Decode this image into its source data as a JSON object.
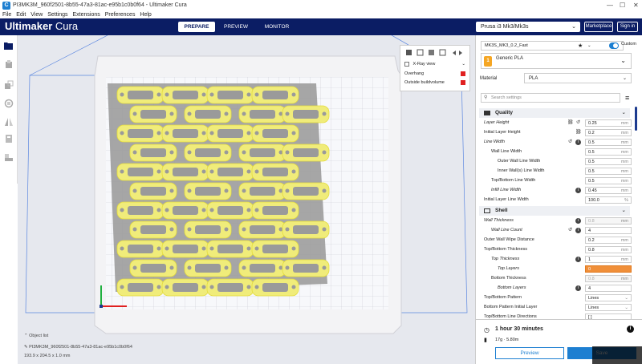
{
  "window": {
    "title": "PI3MK3M_960f2501-8b55-47a3-81ac-e95b1c0b0f64 - Ultimaker Cura",
    "app_icon": "C"
  },
  "menu": [
    "File",
    "Edit",
    "View",
    "Settings",
    "Extensions",
    "Preferences",
    "Help"
  ],
  "header": {
    "brand_bold": "Ultimaker",
    "brand_light": "Cura",
    "stages": [
      "PREPARE",
      "PREVIEW",
      "MONITOR"
    ],
    "active_stage": "PREPARE",
    "printer": "Prusa i3 Mk3/Mk3s",
    "marketplace": "Marketplace",
    "signin": "Sign in"
  },
  "toolbar": [
    "open-file-icon",
    "move-icon",
    "scale-icon",
    "rotate-icon",
    "mirror-icon",
    "per-model-settings-icon",
    "support-blocker-icon"
  ],
  "view_options": {
    "xray": "X-Ray view",
    "overhang": "Overhang",
    "outside": "Outside buildvolume",
    "overhang_color": "#e02020",
    "outside_color": "#e02020"
  },
  "panel": {
    "profile": "MK3S_MK3_0.2_Fast",
    "custom": "Custom",
    "extruder_badge": "1",
    "material_name": "Generic PLA",
    "material_label": "Material",
    "material_value": "PLA",
    "search_placeholder": "Search settings",
    "categories": {
      "quality": "Quality",
      "shell": "Shell"
    },
    "quality": [
      {
        "label": "Layer Height",
        "value": "0.25",
        "unit": "mm"
      },
      {
        "label": "Initial Layer Height",
        "value": "0.2",
        "unit": "mm"
      },
      {
        "label": "Line Width",
        "value": "0.5",
        "unit": "mm"
      },
      {
        "label": "Wall Line Width",
        "value": "0.5",
        "unit": "mm"
      },
      {
        "label": "Outer Wall Line Width",
        "value": "0.5",
        "unit": "mm"
      },
      {
        "label": "Inner Wall(s) Line Width",
        "value": "0.5",
        "unit": "mm"
      },
      {
        "label": "Top/Bottom Line Width",
        "value": "0.5",
        "unit": "mm"
      },
      {
        "label": "Infill Line Width",
        "value": "0.45",
        "unit": "mm"
      },
      {
        "label": "Initial Layer Line Width",
        "value": "100.0",
        "unit": "%"
      }
    ],
    "shell": [
      {
        "label": "Wall Thickness",
        "value": "0.8",
        "unit": "mm"
      },
      {
        "label": "Wall Line Count",
        "value": "4",
        "unit": ""
      },
      {
        "label": "Outer Wall Wipe Distance",
        "value": "0.2",
        "unit": "mm"
      },
      {
        "label": "Top/Bottom Thickness",
        "value": "0.8",
        "unit": "mm"
      },
      {
        "label": "Top Thickness",
        "value": "1",
        "unit": "mm"
      },
      {
        "label": "Top Layers",
        "value": "0",
        "unit": ""
      },
      {
        "label": "Bottom Thickness",
        "value": "0.8",
        "unit": "mm"
      },
      {
        "label": "Bottom Layers",
        "value": "4",
        "unit": ""
      },
      {
        "label": "Top/Bottom Pattern",
        "value": "Lines",
        "unit": ""
      },
      {
        "label": "Bottom Pattern Initial Layer",
        "value": "Lines",
        "unit": ""
      },
      {
        "label": "Top/Bottom Line Directions",
        "value": "[ ]",
        "unit": ""
      }
    ]
  },
  "print_summary": {
    "time": "1 hour 30 minutes",
    "material": "17g · 5.80m",
    "preview": "Preview",
    "save": "Save"
  },
  "object_list": {
    "title": "Object list",
    "name": "PI3MK3M_960f2501-8b55-47a3-81ac-e95b1c0b0f64",
    "dims": "193.9 x 204.5 x 1.0 mm"
  },
  "colors": {
    "topbar": "#0b1d64",
    "accent": "#1d7fd1",
    "model": "#f0ec7a",
    "error": "#f08f39"
  }
}
